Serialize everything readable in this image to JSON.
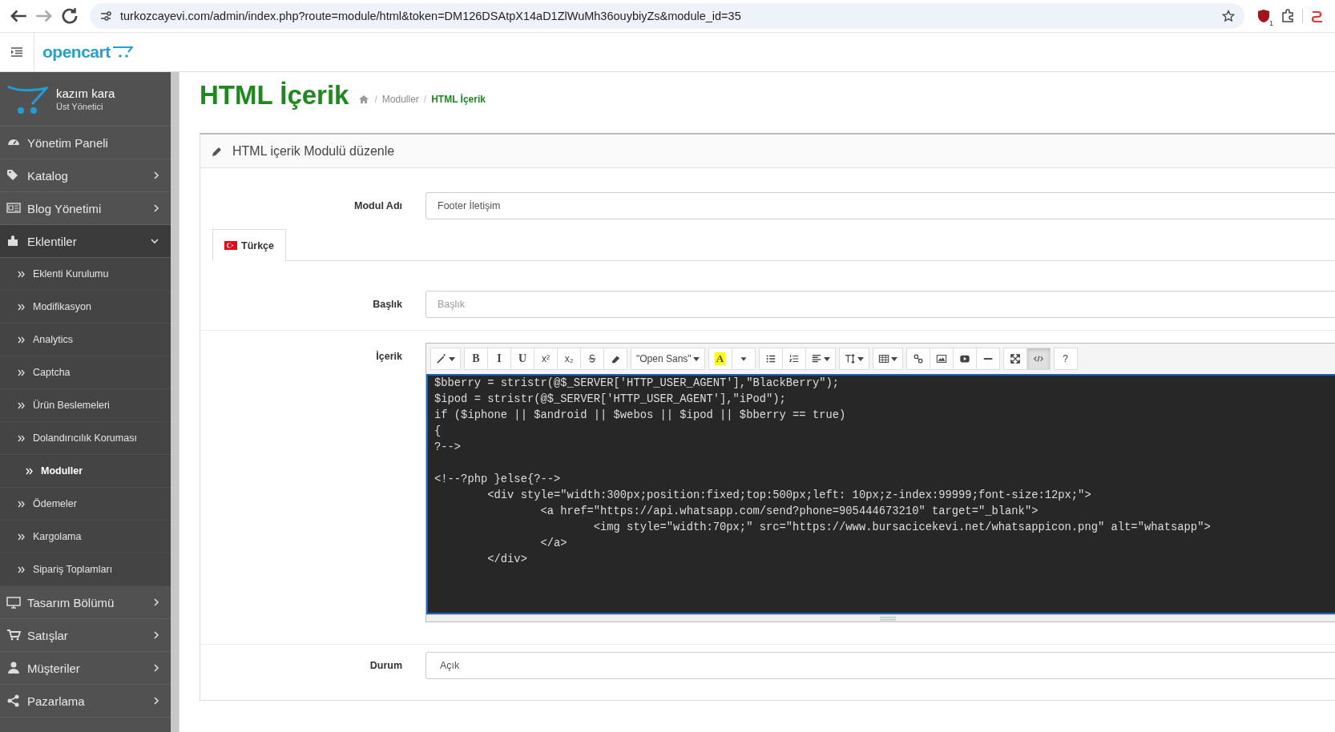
{
  "browser": {
    "url": "turkozcayevi.com/admin/index.php?route=module/html&token=DM126DSAtpX14aD1ZlWuMh36ouybiyZs&module_id=35",
    "extension_badge": "1"
  },
  "header": {
    "logo": "opencart"
  },
  "sidebar": {
    "user": {
      "name": "kazım kara",
      "role": "Üst Yönetici"
    },
    "items": [
      {
        "label": "Yönetim Paneli",
        "kind": "link",
        "expanded": false
      },
      {
        "label": "Katalog",
        "kind": "menu",
        "expanded": false
      },
      {
        "label": "Blog Yönetimi",
        "kind": "menu",
        "expanded": false
      },
      {
        "label": "Eklentiler",
        "kind": "menu",
        "expanded": true,
        "children": [
          {
            "label": "Eklenti Kurulumu",
            "selected": false
          },
          {
            "label": "Modifikasyon",
            "selected": false
          },
          {
            "label": "Analytics",
            "selected": false
          },
          {
            "label": "Captcha",
            "selected": false
          },
          {
            "label": "Ürün Beslemeleri",
            "selected": false
          },
          {
            "label": "Dolandırıcılık Koruması",
            "selected": false
          },
          {
            "label": "Moduller",
            "selected": true
          },
          {
            "label": "Ödemeler",
            "selected": false
          },
          {
            "label": "Kargolama",
            "selected": false
          },
          {
            "label": "Sipariş Toplamları",
            "selected": false
          }
        ]
      },
      {
        "label": "Tasarım Bölümü",
        "kind": "menu",
        "expanded": false
      },
      {
        "label": "Satışlar",
        "kind": "menu",
        "expanded": false
      },
      {
        "label": "Müşteriler",
        "kind": "menu",
        "expanded": false
      },
      {
        "label": "Pazarlama",
        "kind": "menu",
        "expanded": false
      }
    ]
  },
  "page": {
    "title": "HTML İçerik",
    "breadcrumb_separator": "/",
    "breadcrumb": [
      "Moduller",
      "HTML İçerik"
    ]
  },
  "panel": {
    "heading": "HTML içerik Modulü düzenle",
    "module_name": {
      "label": "Modul Adı",
      "value": "Footer İletişim"
    },
    "tabs": [
      {
        "label": "Türkçe",
        "selected": true
      }
    ],
    "title_field": {
      "label": "Başlık",
      "placeholder": "Başlık"
    },
    "content_label": "İçerik",
    "editor": {
      "toolbar": [
        {
          "buttons": [
            {
              "kind": "icon",
              "dropdown": true,
              "active": false
            }
          ]
        },
        {
          "buttons": [
            {
              "kind": "text",
              "label": "B",
              "dropdown": false,
              "active": false
            },
            {
              "kind": "text",
              "label": "I",
              "dropdown": false,
              "active": false
            },
            {
              "kind": "text",
              "label": "U",
              "dropdown": false,
              "active": false
            },
            {
              "kind": "text",
              "label": "x²",
              "dropdown": false,
              "active": false
            },
            {
              "kind": "text",
              "label": "x₂",
              "dropdown": false,
              "active": false
            },
            {
              "kind": "icon",
              "dropdown": false,
              "active": false
            },
            {
              "kind": "icon",
              "dropdown": false,
              "active": false
            }
          ]
        },
        {
          "buttons": [
            {
              "kind": "text",
              "label": "\"Open Sans\"",
              "dropdown": true,
              "active": false
            }
          ]
        },
        {
          "buttons": [
            {
              "kind": "highlight",
              "label": "A",
              "dropdown": false,
              "active": false
            },
            {
              "kind": "icon",
              "dropdown": false,
              "active": false
            }
          ]
        },
        {
          "buttons": [
            {
              "kind": "icon",
              "dropdown": false,
              "active": false
            },
            {
              "kind": "icon",
              "dropdown": false,
              "active": false
            },
            {
              "kind": "icon",
              "dropdown": true,
              "active": false
            }
          ]
        },
        {
          "buttons": [
            {
              "kind": "icon",
              "dropdown": true,
              "active": false
            }
          ]
        },
        {
          "buttons": [
            {
              "kind": "icon",
              "dropdown": true,
              "active": false
            }
          ]
        },
        {
          "buttons": [
            {
              "kind": "icon",
              "dropdown": false,
              "active": false
            },
            {
              "kind": "icon",
              "dropdown": false,
              "active": false
            },
            {
              "kind": "icon",
              "dropdown": false,
              "active": false
            },
            {
              "kind": "icon",
              "dropdown": false,
              "active": false
            }
          ]
        },
        {
          "buttons": [
            {
              "kind": "icon",
              "dropdown": false,
              "active": false
            },
            {
              "kind": "icon",
              "dropdown": false,
              "active": true
            }
          ]
        },
        {
          "buttons": [
            {
              "kind": "text",
              "label": "?",
              "dropdown": false,
              "active": false
            }
          ]
        }
      ],
      "code": "$bberry = stristr(@$_SERVER['HTTP_USER_AGENT'],\"BlackBerry\");\n$ipod = stristr(@$_SERVER['HTTP_USER_AGENT'],\"iPod\");\nif ($iphone || $android || $webos || $ipod || $bberry == true)\n{\n?-->\n\n<!--?php }else{?-->\n\t<div style=\"width:300px;position:fixed;top:500px;left: 10px;z-index:99999;font-size:12px;\">\n\t\t<a href=\"https://api.whatsapp.com/send?phone=905444673210\" target=\"_blank\">\n\t\t\t<img style=\"width:70px;\" src=\"https://www.bursacicekevi.net/whatsappicon.png\" alt=\"whatsapp\">\n\t\t</a>\n\t</div>"
    },
    "status": {
      "label": "Durum",
      "value": "Açık"
    }
  }
}
